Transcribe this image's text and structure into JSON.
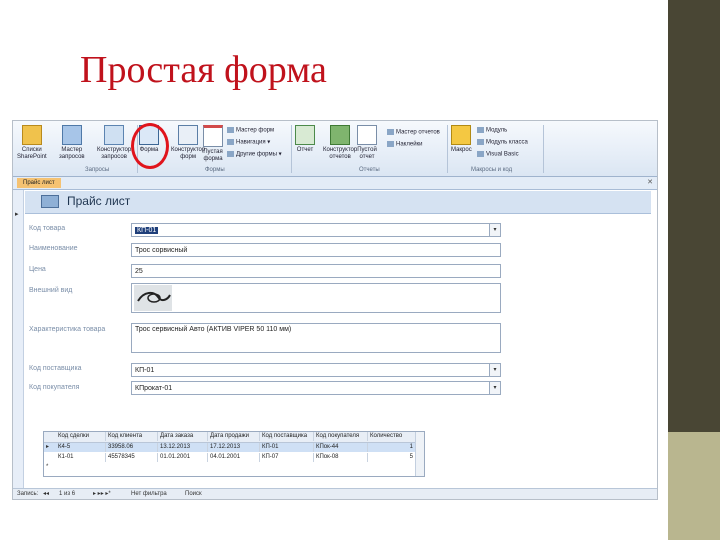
{
  "slide": {
    "title": "Простая форма"
  },
  "ribbon": {
    "items": [
      {
        "label": "Списки\nSharePoint"
      },
      {
        "label": "Мастер\nзапросов"
      },
      {
        "label": "Конструктор\nзапросов"
      },
      {
        "label": "Форма"
      },
      {
        "label": "Конструктор\nформ"
      },
      {
        "label": "Пустая\nформа"
      },
      {
        "label": "Отчет"
      },
      {
        "label": "Конструктор\nотчетов"
      },
      {
        "label": "Пустой\nотчет"
      },
      {
        "label": "Макрос"
      }
    ],
    "small": {
      "form_wizard": "Мастер форм",
      "navigation": "Навигация",
      "more_forms": "Другие формы",
      "report_wizard": "Мастер отчетов",
      "labels": "Наклейки",
      "module": "Модуль",
      "class_module": "Модуль класса",
      "vba": "Visual Basic"
    },
    "groups": {
      "queries": "Запросы",
      "forms": "Формы",
      "reports": "Отчеты",
      "macros": "Макросы и код"
    }
  },
  "doc_tab": "Прайс лист",
  "form": {
    "title": "Прайс лист",
    "fields": [
      {
        "label": "Код товара",
        "value": "КП-01",
        "dropdown": true
      },
      {
        "label": "Наименование",
        "value": "Трос cорвисный",
        "dropdown": false
      },
      {
        "label": "Цена",
        "value": "25",
        "dropdown": false
      },
      {
        "label": "Внешний вид",
        "value": "",
        "dropdown": false
      },
      {
        "label": "Характеристика товара",
        "value": "Трос сервисный Авто (АКТИВ VIPER 50 110 мм)",
        "dropdown": false
      },
      {
        "label": "Код поставщика",
        "value": "КП-01",
        "dropdown": true
      },
      {
        "label": "Код покупателя",
        "value": "КПрокат-01",
        "dropdown": true
      }
    ]
  },
  "subform": {
    "columns": [
      "Код сделки",
      "Код клиента",
      "Дата заказа",
      "Дата продажи",
      "Код поставщика",
      "Код покупателя",
      "Количество"
    ],
    "rows": [
      [
        "К4-5",
        "33958.06",
        "13.12.2013",
        "17.12.2013",
        "КП-01",
        "КПок-44",
        "1"
      ],
      [
        "К1-01",
        "45578345",
        "01.01.2001",
        "04.01.2001",
        "КП-07",
        "КПок-08",
        "5"
      ]
    ]
  },
  "status": {
    "record_label": "Запись:",
    "record_of": "1 из 6",
    "filter": "Нет фильтра",
    "search": "Поиск"
  },
  "colors": {
    "title_red": "#c0121c",
    "side_dark": "#494634",
    "side_light": "#b9b68f",
    "highlight_circle": "#e0141c"
  },
  "icons": [
    "table-view-icon",
    "query-wizard-icon",
    "form-icon",
    "report-icon",
    "macro-icon"
  ]
}
